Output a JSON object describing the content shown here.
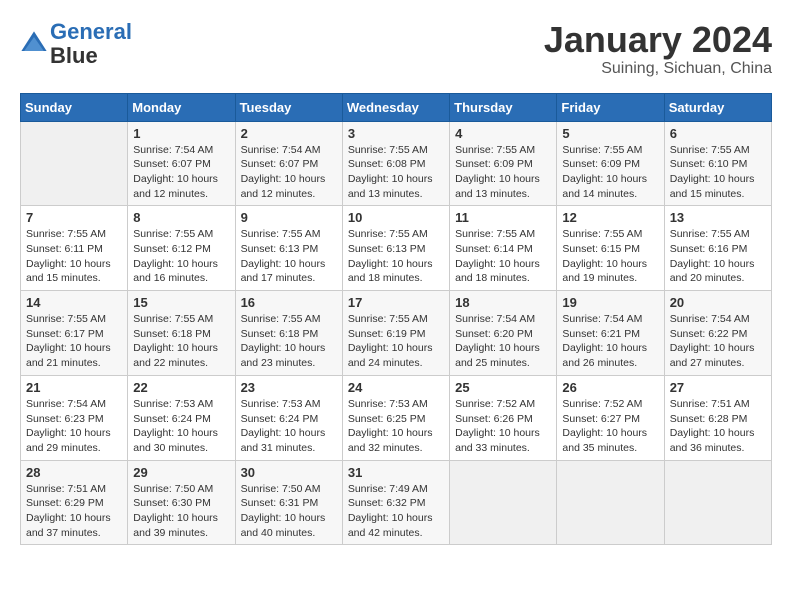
{
  "header": {
    "logo_line1": "General",
    "logo_line2": "Blue",
    "month_title": "January 2024",
    "location": "Suining, Sichuan, China"
  },
  "weekdays": [
    "Sunday",
    "Monday",
    "Tuesday",
    "Wednesday",
    "Thursday",
    "Friday",
    "Saturday"
  ],
  "weeks": [
    [
      {
        "day": "",
        "sunrise": "",
        "sunset": "",
        "daylight": ""
      },
      {
        "day": "1",
        "sunrise": "Sunrise: 7:54 AM",
        "sunset": "Sunset: 6:07 PM",
        "daylight": "Daylight: 10 hours and 12 minutes."
      },
      {
        "day": "2",
        "sunrise": "Sunrise: 7:54 AM",
        "sunset": "Sunset: 6:07 PM",
        "daylight": "Daylight: 10 hours and 12 minutes."
      },
      {
        "day": "3",
        "sunrise": "Sunrise: 7:55 AM",
        "sunset": "Sunset: 6:08 PM",
        "daylight": "Daylight: 10 hours and 13 minutes."
      },
      {
        "day": "4",
        "sunrise": "Sunrise: 7:55 AM",
        "sunset": "Sunset: 6:09 PM",
        "daylight": "Daylight: 10 hours and 13 minutes."
      },
      {
        "day": "5",
        "sunrise": "Sunrise: 7:55 AM",
        "sunset": "Sunset: 6:09 PM",
        "daylight": "Daylight: 10 hours and 14 minutes."
      },
      {
        "day": "6",
        "sunrise": "Sunrise: 7:55 AM",
        "sunset": "Sunset: 6:10 PM",
        "daylight": "Daylight: 10 hours and 15 minutes."
      }
    ],
    [
      {
        "day": "7",
        "sunrise": "Sunrise: 7:55 AM",
        "sunset": "Sunset: 6:11 PM",
        "daylight": "Daylight: 10 hours and 15 minutes."
      },
      {
        "day": "8",
        "sunrise": "Sunrise: 7:55 AM",
        "sunset": "Sunset: 6:12 PM",
        "daylight": "Daylight: 10 hours and 16 minutes."
      },
      {
        "day": "9",
        "sunrise": "Sunrise: 7:55 AM",
        "sunset": "Sunset: 6:13 PM",
        "daylight": "Daylight: 10 hours and 17 minutes."
      },
      {
        "day": "10",
        "sunrise": "Sunrise: 7:55 AM",
        "sunset": "Sunset: 6:13 PM",
        "daylight": "Daylight: 10 hours and 18 minutes."
      },
      {
        "day": "11",
        "sunrise": "Sunrise: 7:55 AM",
        "sunset": "Sunset: 6:14 PM",
        "daylight": "Daylight: 10 hours and 18 minutes."
      },
      {
        "day": "12",
        "sunrise": "Sunrise: 7:55 AM",
        "sunset": "Sunset: 6:15 PM",
        "daylight": "Daylight: 10 hours and 19 minutes."
      },
      {
        "day": "13",
        "sunrise": "Sunrise: 7:55 AM",
        "sunset": "Sunset: 6:16 PM",
        "daylight": "Daylight: 10 hours and 20 minutes."
      }
    ],
    [
      {
        "day": "14",
        "sunrise": "Sunrise: 7:55 AM",
        "sunset": "Sunset: 6:17 PM",
        "daylight": "Daylight: 10 hours and 21 minutes."
      },
      {
        "day": "15",
        "sunrise": "Sunrise: 7:55 AM",
        "sunset": "Sunset: 6:18 PM",
        "daylight": "Daylight: 10 hours and 22 minutes."
      },
      {
        "day": "16",
        "sunrise": "Sunrise: 7:55 AM",
        "sunset": "Sunset: 6:18 PM",
        "daylight": "Daylight: 10 hours and 23 minutes."
      },
      {
        "day": "17",
        "sunrise": "Sunrise: 7:55 AM",
        "sunset": "Sunset: 6:19 PM",
        "daylight": "Daylight: 10 hours and 24 minutes."
      },
      {
        "day": "18",
        "sunrise": "Sunrise: 7:54 AM",
        "sunset": "Sunset: 6:20 PM",
        "daylight": "Daylight: 10 hours and 25 minutes."
      },
      {
        "day": "19",
        "sunrise": "Sunrise: 7:54 AM",
        "sunset": "Sunset: 6:21 PM",
        "daylight": "Daylight: 10 hours and 26 minutes."
      },
      {
        "day": "20",
        "sunrise": "Sunrise: 7:54 AM",
        "sunset": "Sunset: 6:22 PM",
        "daylight": "Daylight: 10 hours and 27 minutes."
      }
    ],
    [
      {
        "day": "21",
        "sunrise": "Sunrise: 7:54 AM",
        "sunset": "Sunset: 6:23 PM",
        "daylight": "Daylight: 10 hours and 29 minutes."
      },
      {
        "day": "22",
        "sunrise": "Sunrise: 7:53 AM",
        "sunset": "Sunset: 6:24 PM",
        "daylight": "Daylight: 10 hours and 30 minutes."
      },
      {
        "day": "23",
        "sunrise": "Sunrise: 7:53 AM",
        "sunset": "Sunset: 6:24 PM",
        "daylight": "Daylight: 10 hours and 31 minutes."
      },
      {
        "day": "24",
        "sunrise": "Sunrise: 7:53 AM",
        "sunset": "Sunset: 6:25 PM",
        "daylight": "Daylight: 10 hours and 32 minutes."
      },
      {
        "day": "25",
        "sunrise": "Sunrise: 7:52 AM",
        "sunset": "Sunset: 6:26 PM",
        "daylight": "Daylight: 10 hours and 33 minutes."
      },
      {
        "day": "26",
        "sunrise": "Sunrise: 7:52 AM",
        "sunset": "Sunset: 6:27 PM",
        "daylight": "Daylight: 10 hours and 35 minutes."
      },
      {
        "day": "27",
        "sunrise": "Sunrise: 7:51 AM",
        "sunset": "Sunset: 6:28 PM",
        "daylight": "Daylight: 10 hours and 36 minutes."
      }
    ],
    [
      {
        "day": "28",
        "sunrise": "Sunrise: 7:51 AM",
        "sunset": "Sunset: 6:29 PM",
        "daylight": "Daylight: 10 hours and 37 minutes."
      },
      {
        "day": "29",
        "sunrise": "Sunrise: 7:50 AM",
        "sunset": "Sunset: 6:30 PM",
        "daylight": "Daylight: 10 hours and 39 minutes."
      },
      {
        "day": "30",
        "sunrise": "Sunrise: 7:50 AM",
        "sunset": "Sunset: 6:31 PM",
        "daylight": "Daylight: 10 hours and 40 minutes."
      },
      {
        "day": "31",
        "sunrise": "Sunrise: 7:49 AM",
        "sunset": "Sunset: 6:32 PM",
        "daylight": "Daylight: 10 hours and 42 minutes."
      },
      {
        "day": "",
        "sunrise": "",
        "sunset": "",
        "daylight": ""
      },
      {
        "day": "",
        "sunrise": "",
        "sunset": "",
        "daylight": ""
      },
      {
        "day": "",
        "sunrise": "",
        "sunset": "",
        "daylight": ""
      }
    ]
  ]
}
